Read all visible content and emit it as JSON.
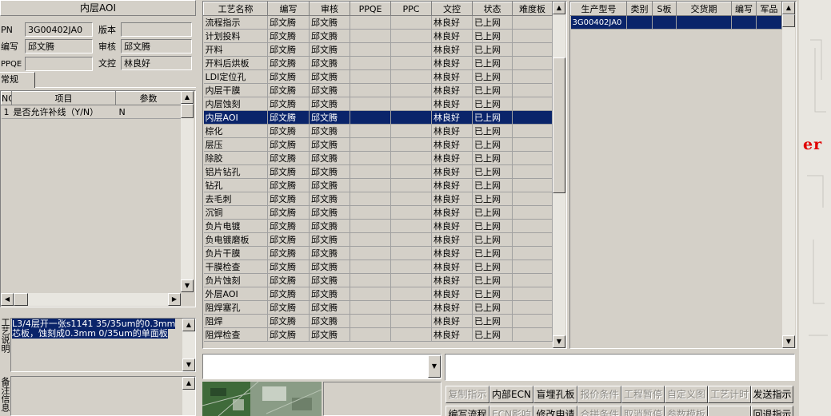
{
  "left_panel": {
    "title": "内层AOI",
    "pn_label": "PN",
    "pn_value": "3G00402JA0",
    "version_label": "版本",
    "version_value": "",
    "writer_label": "编写",
    "writer_value": "邱文腾",
    "reviewer_label": "审核",
    "reviewer_value": "邱文腾",
    "ppqe_label": "PPQE",
    "ppqe_value": "",
    "doc_control_label": "文控",
    "doc_control_value": "林良好",
    "tab_general": "常规",
    "param_table": {
      "headers": [
        "NO",
        "项目",
        "参数"
      ],
      "rows": [
        [
          "1",
          "是否允许补线（Y/N）",
          "N"
        ]
      ]
    },
    "process_note_label": "工艺说明",
    "process_note_text": "L3/4层开一张s1141 35/35um的0.3mm芯板，蚀刻成0.3mm 0/35um的单面板",
    "other_note_label": "备注信息"
  },
  "process_table": {
    "headers": [
      "工艺名称",
      "编写",
      "审核",
      "PPQE",
      "PPC",
      "文控",
      "状态",
      "难度板"
    ],
    "selected_index": 7,
    "rows": [
      [
        "流程指示",
        "邱文腾",
        "邱文腾",
        "",
        "",
        "林良好",
        "已上网",
        ""
      ],
      [
        "计划投料",
        "邱文腾",
        "邱文腾",
        "",
        "",
        "林良好",
        "已上网",
        ""
      ],
      [
        "开料",
        "邱文腾",
        "邱文腾",
        "",
        "",
        "林良好",
        "已上网",
        ""
      ],
      [
        "开料后烘板",
        "邱文腾",
        "邱文腾",
        "",
        "",
        "林良好",
        "已上网",
        ""
      ],
      [
        "LDI定位孔",
        "邱文腾",
        "邱文腾",
        "",
        "",
        "林良好",
        "已上网",
        ""
      ],
      [
        "内层干膜",
        "邱文腾",
        "邱文腾",
        "",
        "",
        "林良好",
        "已上网",
        ""
      ],
      [
        "内层蚀刻",
        "邱文腾",
        "邱文腾",
        "",
        "",
        "林良好",
        "已上网",
        ""
      ],
      [
        "内层AOI",
        "邱文腾",
        "邱文腾",
        "",
        "",
        "林良好",
        "已上网",
        ""
      ],
      [
        "棕化",
        "邱文腾",
        "邱文腾",
        "",
        "",
        "林良好",
        "已上网",
        ""
      ],
      [
        "层压",
        "邱文腾",
        "邱文腾",
        "",
        "",
        "林良好",
        "已上网",
        ""
      ],
      [
        "除胶",
        "邱文腾",
        "邱文腾",
        "",
        "",
        "林良好",
        "已上网",
        ""
      ],
      [
        "铝片钻孔",
        "邱文腾",
        "邱文腾",
        "",
        "",
        "林良好",
        "已上网",
        ""
      ],
      [
        "钻孔",
        "邱文腾",
        "邱文腾",
        "",
        "",
        "林良好",
        "已上网",
        ""
      ],
      [
        "去毛刺",
        "邱文腾",
        "邱文腾",
        "",
        "",
        "林良好",
        "已上网",
        ""
      ],
      [
        "沉铜",
        "邱文腾",
        "邱文腾",
        "",
        "",
        "林良好",
        "已上网",
        ""
      ],
      [
        "负片电镀",
        "邱文腾",
        "邱文腾",
        "",
        "",
        "林良好",
        "已上网",
        ""
      ],
      [
        "负电镀磨板",
        "邱文腾",
        "邱文腾",
        "",
        "",
        "林良好",
        "已上网",
        ""
      ],
      [
        "负片干膜",
        "邱文腾",
        "邱文腾",
        "",
        "",
        "林良好",
        "已上网",
        ""
      ],
      [
        "干膜检查",
        "邱文腾",
        "邱文腾",
        "",
        "",
        "林良好",
        "已上网",
        ""
      ],
      [
        "负片蚀刻",
        "邱文腾",
        "邱文腾",
        "",
        "",
        "林良好",
        "已上网",
        ""
      ],
      [
        "外层AOI",
        "邱文腾",
        "邱文腾",
        "",
        "",
        "林良好",
        "已上网",
        ""
      ],
      [
        "阻焊塞孔",
        "邱文腾",
        "邱文腾",
        "",
        "",
        "林良好",
        "已上网",
        ""
      ],
      [
        "阻焊",
        "邱文腾",
        "邱文腾",
        "",
        "",
        "林良好",
        "已上网",
        ""
      ],
      [
        "阻焊检查",
        "邱文腾",
        "邱文腾",
        "",
        "",
        "林良好",
        "已上网",
        ""
      ]
    ]
  },
  "model_table": {
    "headers": [
      "生产型号",
      "类别",
      "S板",
      "交货期",
      "编写",
      "军品"
    ],
    "rows": [
      [
        "3G00402JA0",
        "",
        "",
        "",
        "",
        ""
      ]
    ]
  },
  "buttons_row1": [
    {
      "label": "复制指示",
      "enabled": false
    },
    {
      "label": "内部ECN",
      "enabled": true
    },
    {
      "label": "盲埋孔板",
      "enabled": true
    },
    {
      "label": "报价条件",
      "enabled": false
    },
    {
      "label": "工程暂停",
      "enabled": false
    },
    {
      "label": "自定义图",
      "enabled": false
    },
    {
      "label": "工艺计时",
      "enabled": false
    },
    {
      "label": "发送指示",
      "enabled": true
    }
  ],
  "buttons_row2": [
    {
      "label": "编写流程",
      "enabled": true
    },
    {
      "label": "ECN影响",
      "enabled": false
    },
    {
      "label": "修改申请",
      "enabled": true
    },
    {
      "label": "合拼条件",
      "enabled": false
    },
    {
      "label": "取消暂停",
      "enabled": false
    },
    {
      "label": "参数模板",
      "enabled": false
    },
    {
      "label": "",
      "enabled": false
    },
    {
      "label": "回退指示",
      "enabled": true
    }
  ],
  "background_fragment": "er",
  "colors": {
    "face": "#d4d0c8",
    "selection": "#0a246a",
    "accent_red": "#e00000"
  }
}
